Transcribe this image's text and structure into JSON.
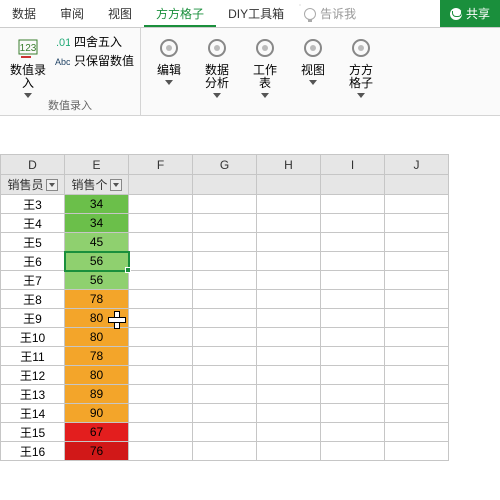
{
  "tabs": {
    "items": [
      "数据",
      "审阅",
      "视图",
      "方方格子",
      "DIY工具箱"
    ],
    "active_index": 3,
    "tellme": "告诉我",
    "share": "共享"
  },
  "ribbon": {
    "group_numin": {
      "big": "数值录入",
      "items": [
        "四舍五入",
        "只保留数值"
      ],
      "label": "数值录入"
    },
    "group_tools": {
      "items": [
        "编辑",
        "数据分析",
        "工作表",
        "视图",
        "方方格子"
      ]
    }
  },
  "sheet": {
    "columns": [
      "D",
      "E",
      "F",
      "G",
      "H",
      "I",
      "J"
    ],
    "headers": {
      "d": "销售员",
      "e": "销售个"
    },
    "rows": [
      {
        "d": "王3",
        "e": "34",
        "c": "g"
      },
      {
        "d": "王4",
        "e": "34",
        "c": "g"
      },
      {
        "d": "王5",
        "e": "45",
        "c": "g2"
      },
      {
        "d": "王6",
        "e": "56",
        "c": "g2",
        "sel": true
      },
      {
        "d": "王7",
        "e": "56",
        "c": "g2"
      },
      {
        "d": "王8",
        "e": "78",
        "c": "o"
      },
      {
        "d": "王9",
        "e": "80",
        "c": "o",
        "cursor": true
      },
      {
        "d": "王10",
        "e": "80",
        "c": "o"
      },
      {
        "d": "王11",
        "e": "78",
        "c": "o"
      },
      {
        "d": "王12",
        "e": "80",
        "c": "o"
      },
      {
        "d": "王13",
        "e": "89",
        "c": "o"
      },
      {
        "d": "王14",
        "e": "90",
        "c": "o"
      },
      {
        "d": "王15",
        "e": "67",
        "c": "r"
      },
      {
        "d": "王16",
        "e": "76",
        "c": "r dark"
      }
    ]
  }
}
